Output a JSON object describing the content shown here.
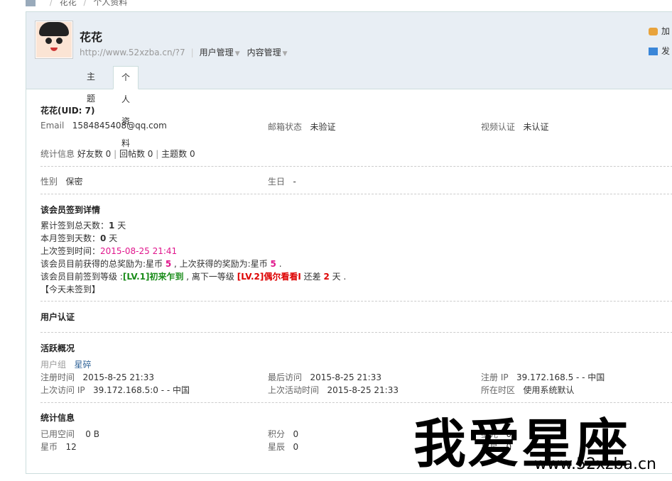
{
  "breadcrumb": {
    "items": [
      "花花",
      "个人资料"
    ]
  },
  "header": {
    "username": "花花",
    "url": "http://www.52xzba.cn/?7",
    "menus": [
      "用户管理",
      "内容管理"
    ],
    "side_actions": [
      "加",
      "发"
    ]
  },
  "tabs": [
    {
      "label": "主题"
    },
    {
      "label": "个人资料"
    }
  ],
  "profile": {
    "name_uid": "花花(UID: 7)",
    "email_label": "Email",
    "email_value": "1584845408@qq.com",
    "email_status_label": "邮箱状态",
    "email_status_value": "未验证",
    "video_label": "视频认证",
    "video_value": "未认证",
    "stats_label": "统计信息",
    "stats": [
      "好友数 0",
      "回帖数 0",
      "主题数 0"
    ],
    "gender_label": "性别",
    "gender_value": "保密",
    "birthday_label": "生日",
    "birthday_value": "-"
  },
  "signin": {
    "title": "该会员签到详情",
    "total_prefix": "累计签到总天数：",
    "total_value": "1",
    "total_suffix": " 天",
    "month_prefix": "本月签到天数：",
    "month_value": "0",
    "month_suffix": " 天",
    "last_prefix": "上次签到时间：",
    "last_value": "2015-08-25 21:41",
    "reward_prefix": "该会员目前获得的总奖励为:星币 ",
    "reward_total": "5",
    "reward_mid": " , 上次获得的奖励为:星币 ",
    "reward_last": "5",
    "reward_suffix": " .",
    "level_prefix": "该会员目前签到等级 :",
    "level_current": "[LV.1]初来乍到",
    "level_mid": " , 离下一等级 ",
    "level_next": "[LV.2]偶尔看看I",
    "level_gap_prefix": " 还差 ",
    "level_gap": "2",
    "level_gap_suffix": " 天 .",
    "today": "【今天未签到】"
  },
  "verify": {
    "title": "用户认证"
  },
  "activity": {
    "title": "活跃概况",
    "group_label": "用户组",
    "group_value": "星碎",
    "reg_time_label": "注册时间",
    "reg_time_value": "2015-8-25 21:33",
    "last_visit_label": "最后访问",
    "last_visit_value": "2015-8-25 21:33",
    "reg_ip_label": "注册 IP",
    "reg_ip_value": "39.172.168.5 - - 中国",
    "last_ip_label": "上次访问 IP",
    "last_ip_value": "39.172.168.5:0 - - 中国",
    "last_active_label": "上次活动时间",
    "last_active_value": "2015-8-25 21:33",
    "tz_label": "所在时区",
    "tz_value": "使用系统默认"
  },
  "statistics": {
    "title": "统计信息",
    "space_label": "已用空间",
    "space_value": "0 B",
    "points_label": "积分",
    "points_value": "0",
    "c3a_label": "星光",
    "c3a_value": "0",
    "coin_label": "星币",
    "coin_value": "12",
    "star_label": "星辰",
    "star_value": "0",
    "c3b_label": "星星",
    "c3b_value": "0"
  },
  "watermark": {
    "big": "我爱星座",
    "small": "www.52xzba.cn"
  }
}
